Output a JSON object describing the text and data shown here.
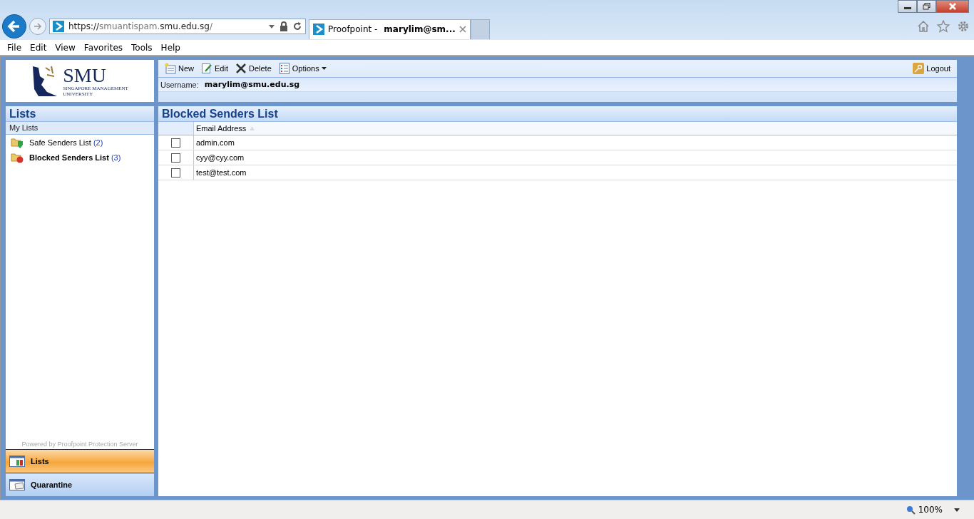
{
  "browser": {
    "url_parts": [
      {
        "text": "https://",
        "dim": false
      },
      {
        "text": "smuantispam.",
        "dim": true
      },
      {
        "text": "smu.edu.sg",
        "dim": false
      },
      {
        "text": "/",
        "dim": true
      }
    ],
    "tab": {
      "title": "Proofpoint -",
      "user": "marylim@sm..."
    },
    "window_buttons": [
      {
        "kind": "minimize"
      },
      {
        "kind": "restore"
      },
      {
        "kind": "close"
      }
    ],
    "menu": [
      "File",
      "Edit",
      "View",
      "Favorites",
      "Tools",
      "Help"
    ],
    "zoom": "100%"
  },
  "logo": {
    "name": "SMU",
    "line1": "SINGAPORE MANAGEMENT",
    "line2": "UNIVERSITY"
  },
  "toolbar": [
    {
      "kind": "new",
      "label": "New"
    },
    {
      "kind": "edit",
      "label": "Edit"
    },
    {
      "kind": "delete",
      "label": "Delete"
    },
    {
      "kind": "options",
      "label": "Options"
    }
  ],
  "logout": "Logout",
  "username": {
    "label": "Username:",
    "value": "marylim@smu.edu.sg"
  },
  "sidebar": {
    "title": "Lists",
    "section": "My Lists",
    "items": [
      {
        "kind": "safe",
        "label": "Safe Senders List",
        "count": "(2)",
        "selected": false
      },
      {
        "kind": "blocked",
        "label": "Blocked Senders List",
        "count": "(3)",
        "selected": true
      }
    ],
    "footer": "Powered by Proofpoint Protection Server",
    "nav": [
      {
        "kind": "lists",
        "label": "Lists",
        "selected": true
      },
      {
        "kind": "quarantine",
        "label": "Quarantine",
        "selected": false
      }
    ]
  },
  "main": {
    "title": "Blocked Senders List",
    "column": "Email Address",
    "rows": [
      {
        "email": "admin.com",
        "checked": false
      },
      {
        "email": "cyy@cyy.com",
        "checked": false
      },
      {
        "email": "test@test.com",
        "checked": false
      }
    ]
  }
}
